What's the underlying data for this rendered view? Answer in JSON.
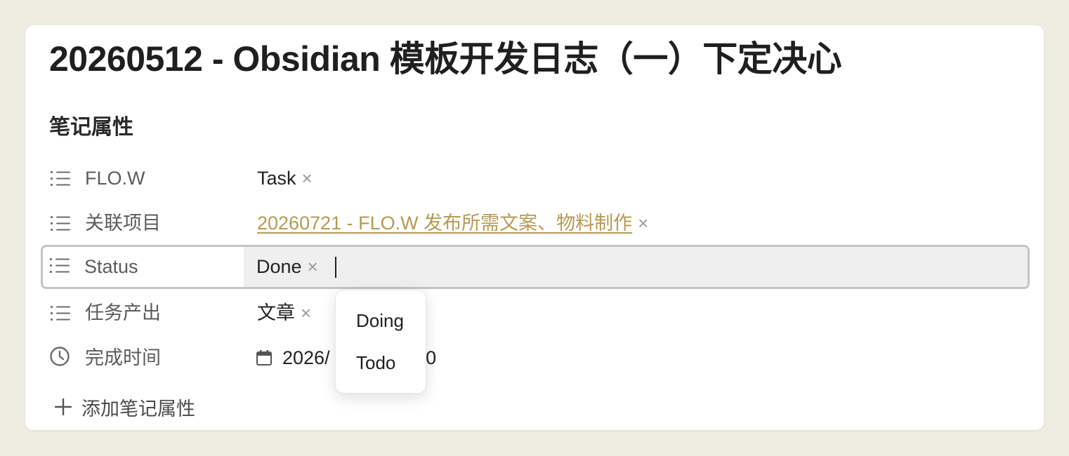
{
  "note": {
    "title": "20260512 - Obsidian 模板开发日志（一）下定决心"
  },
  "properties": {
    "heading": "笔记属性",
    "rows": [
      {
        "icon": "list-icon",
        "key": "FLO.W",
        "value": "Task"
      },
      {
        "icon": "list-icon",
        "key": "关联项目",
        "value": "20260721 - FLO.W 发布所需文案、物料制作",
        "is_link": true
      },
      {
        "icon": "list-icon",
        "key": "Status",
        "value": "Done",
        "active": true
      },
      {
        "icon": "list-icon",
        "key": "任务产出",
        "value": "文章"
      },
      {
        "icon": "clock-icon",
        "key": "完成时间",
        "value_visible_start": "2026/",
        "value_visible_end": ":00",
        "value_icon": "calendar-icon"
      }
    ],
    "add_label": "添加笔记属性",
    "remove_glyph": "×"
  },
  "suggestions": {
    "options": [
      "Doing",
      "Todo"
    ]
  },
  "colors": {
    "background": "#efece1",
    "card": "#ffffff",
    "link": "#b59a55",
    "active_row_border": "#c4c4c4",
    "active_row_fill": "#efefef"
  }
}
